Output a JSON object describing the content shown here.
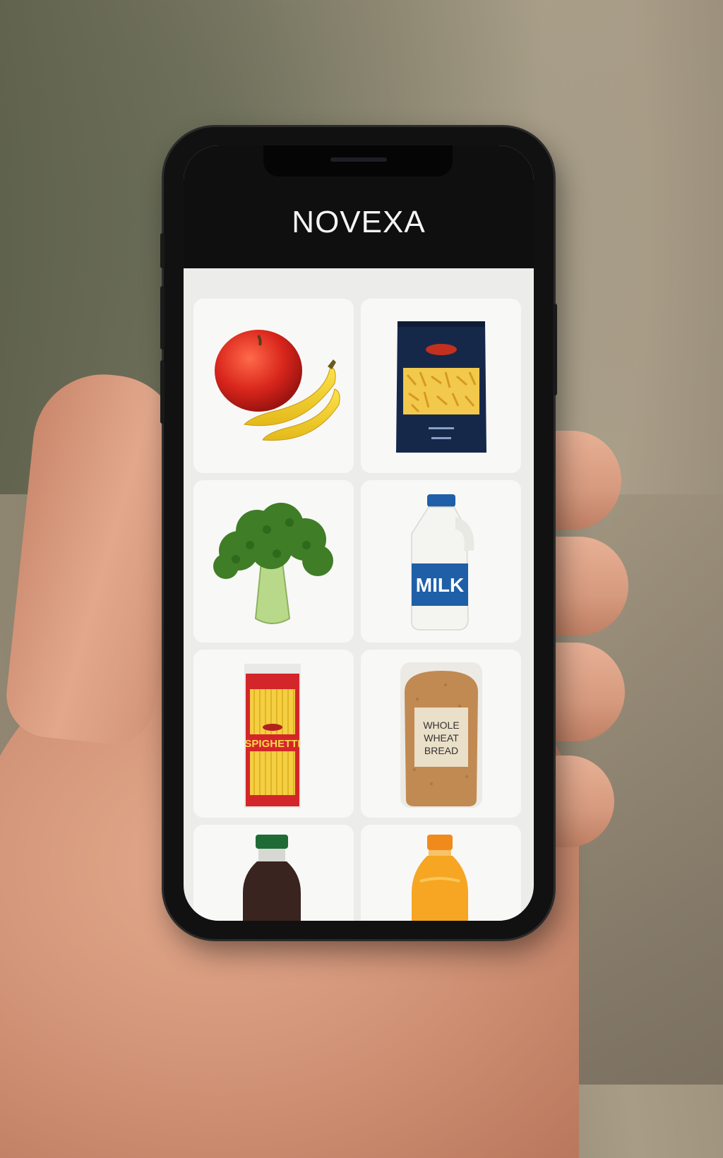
{
  "app": {
    "title": "NOVEXA"
  },
  "products": [
    {
      "name": "apple-and-bananas"
    },
    {
      "name": "pasta-bag"
    },
    {
      "name": "broccoli"
    },
    {
      "name": "milk",
      "label": "MILK"
    },
    {
      "name": "spaghetti",
      "label": "SPIGHETTI"
    },
    {
      "name": "bread",
      "label_line1": "WHOLE",
      "label_line2": "WHEAT",
      "label_line3": "BREAD"
    },
    {
      "name": "dark-soda-bottle"
    },
    {
      "name": "orange-juice-bottle"
    }
  ],
  "colors": {
    "header_bg": "#0f0f10",
    "screen_bg": "#ececea",
    "tile_bg": "#f8f8f7",
    "milk_blue": "#1f5fa8",
    "spaghetti_red": "#d3262a",
    "pasta_navy": "#16284a"
  }
}
